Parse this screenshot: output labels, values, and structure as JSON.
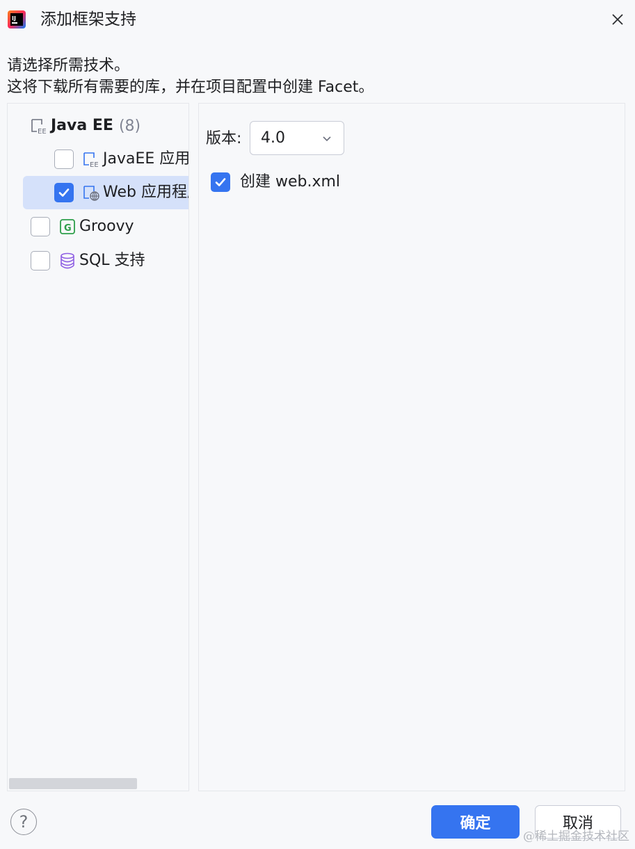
{
  "window": {
    "title": "添加框架支持",
    "logo_icon": "intellij-idea-icon",
    "close_icon": "close-icon"
  },
  "description": {
    "line1": "请选择所需技术。",
    "line2": "这将下载所有需要的库，并在项目配置中创建 Facet。"
  },
  "tree": {
    "javaee_group": {
      "label": "Java EE",
      "count": "(8)",
      "icon": "javaee-icon"
    },
    "items": [
      {
        "label": "JavaEE 应用程",
        "checked": false,
        "icon": "javaee-icon"
      },
      {
        "label": "Web 应用程序",
        "checked": true,
        "icon": "web-module-icon",
        "selected": true
      },
      {
        "label": "Groovy",
        "checked": false,
        "icon": "groovy-icon"
      },
      {
        "label": "SQL 支持",
        "checked": false,
        "icon": "database-icon"
      }
    ]
  },
  "settings": {
    "version_label": "版本:",
    "version_value": "4.0",
    "create_webxml_label": "创建 web.xml",
    "create_webxml_checked": true
  },
  "footer": {
    "help_label": "?",
    "ok_label": "确定",
    "cancel_label": "取消",
    "watermark": "@稀土掘金技术社区"
  },
  "colors": {
    "accent": "#3574f0",
    "selection": "#d5e1fa",
    "background": "#f7f8fa",
    "groovy": "#2e9e4a",
    "database": "#8f5fe3"
  }
}
